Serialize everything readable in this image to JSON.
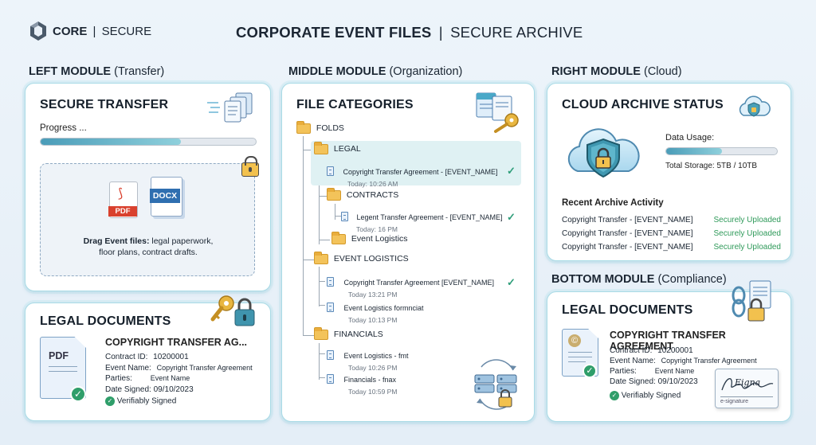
{
  "header": {
    "brand_bold": "CORE",
    "brand_sep": "|",
    "brand_light": "SECURE",
    "title_bold": "CORPORATE EVENT FILES",
    "title_sep": "|",
    "title_light": "SECURE ARCHIVE"
  },
  "modules": {
    "left": {
      "name": "LEFT MODULE",
      "sub": "(Transfer)"
    },
    "middle": {
      "name": "MIDDLE MODULE",
      "sub": "(Organization)"
    },
    "right": {
      "name": "RIGHT MODULE",
      "sub": "(Cloud)"
    },
    "bottom": {
      "name": "BOTTOM MODULE",
      "sub": "(Compliance)"
    }
  },
  "transfer": {
    "title": "SECURE TRANSFER",
    "progress_label": "Progress ...",
    "progress": 0.65,
    "pdf_label": "PDF",
    "docx_label": "DOCX",
    "drop_bold": "Drag Event files:",
    "drop_rest": "legal paperwork,",
    "drop_line2": "floor plans, contract drafts."
  },
  "legal_left": {
    "title": "LEGAL DOCUMENTS",
    "pdf_label": "PDF",
    "doc_title": "COPYRIGHT TRANSFER AG...",
    "rows": [
      {
        "k": "Contract ID:",
        "v": "10200001"
      },
      {
        "k": "Event Name:",
        "v": "Copyright Transfer Agreement"
      },
      {
        "k": "Parties:",
        "v": "Event Name"
      },
      {
        "k": "Date Signed:",
        "v": "09/10/2023"
      }
    ],
    "signed": "Verifiably Signed"
  },
  "categories": {
    "title": "FILE CATEGORIES",
    "root": "FOLDS",
    "legal": "LEGAL",
    "legal_file": {
      "name": "Copyright Transfer Agreement - [EVENT_NAME]",
      "time": "Today: 10:26 AM"
    },
    "contracts": "CONTRACTS",
    "contracts_file": {
      "name": "Legent Transfer Agreement - [EVENT_NAME]",
      "time": "Today: 16 PM"
    },
    "event_logistics_sub": "Event Logistics",
    "event_logistics": "EVENT LOGISTICS",
    "el_file1": {
      "name": "Copyright Transfer Agreement [EVENT_NAME]",
      "time": "Today 13:21 PM"
    },
    "el_file2": {
      "name": "Event Logistics formnciat",
      "time": "Today 10:13 PM"
    },
    "financials": "FINANCIALS",
    "fin_file1": {
      "name": "Event Logistics - fmt",
      "time": "Today 10:26 PM"
    },
    "fin_file2": {
      "name": "Financials - fnax",
      "time": "Today 10:59 PM"
    }
  },
  "cloud": {
    "title": "CLOUD ARCHIVE STATUS",
    "usage_label": "Data Usage:",
    "usage": 0.5,
    "storage": "Total Storage: 5TB / 10TB",
    "activity_title": "Recent Archive Activity",
    "activity": [
      {
        "file": "Copyright Transfer - [EVENT_NAME]",
        "status": "Securely Uploaded"
      },
      {
        "file": "Copyright Transfer - [EVENT_NAME]",
        "status": "Securely Uploaded"
      },
      {
        "file": "Copyright Transfer - [EVENT_NAME]",
        "status": "Securely Uploaded"
      }
    ]
  },
  "legal_right": {
    "title": "LEGAL DOCUMENTS",
    "doc_title": "COPYRIGHT TRANSFER AGREEMENT",
    "rows": [
      {
        "k": "Contract ID:",
        "v": "10200001"
      },
      {
        "k": "Event Name:",
        "v": "Copyright Transfer Agreement"
      },
      {
        "k": "Parties:",
        "v": "Event Name"
      },
      {
        "k": "Date Signed:",
        "v": "09/10/2023"
      }
    ],
    "signed": "Verifiably Signed",
    "signature": "Eigna",
    "esig": "e-signature"
  },
  "colors": {
    "accent": "#4fb0c6",
    "border": "#a9dbe6",
    "success": "#2f9a5a"
  }
}
